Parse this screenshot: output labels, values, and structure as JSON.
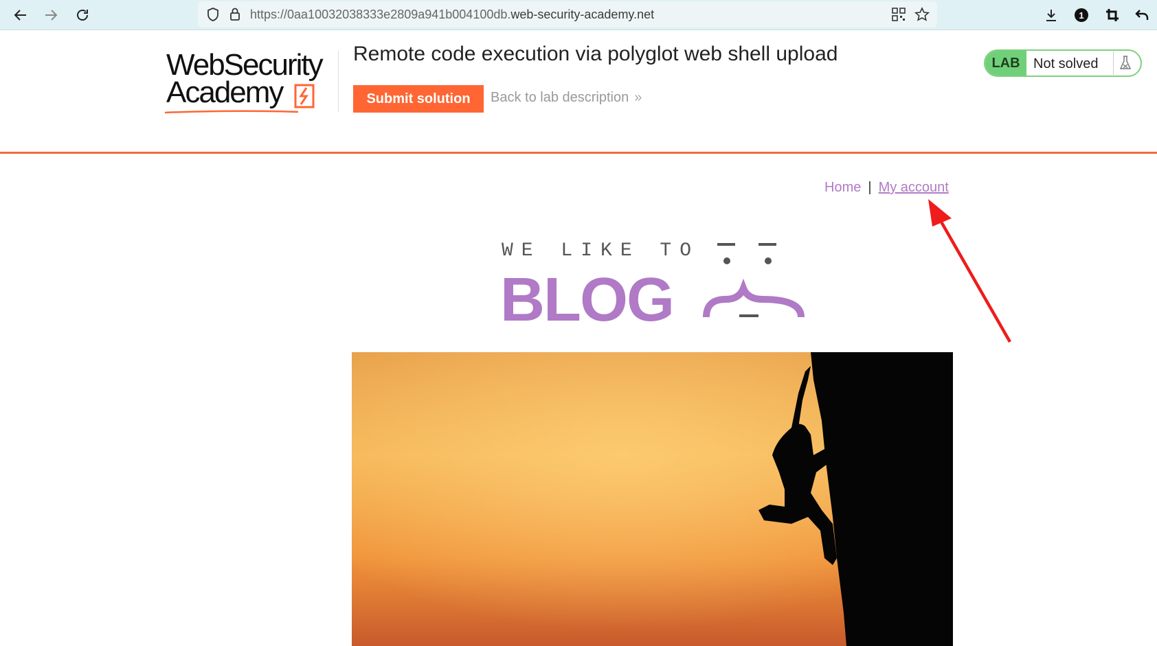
{
  "browser": {
    "url_prefix": "https://0aa10032038333e2809a941b004100db.",
    "url_domain": "web-security-academy.net",
    "badge_count": "1"
  },
  "lab": {
    "logo_line1": "WebSecurity",
    "logo_line2": "Academy",
    "title": "Remote code execution via polyglot web shell upload",
    "submit_label": "Submit solution",
    "back_label": "Back to lab description",
    "status_badge": "LAB",
    "status_text": "Not solved",
    "colors": {
      "accent": "#ff6633",
      "status_green": "#70d07a"
    }
  },
  "blog": {
    "nav": {
      "home": "Home",
      "separator": "|",
      "account": "My account"
    },
    "tagline": "WE LIKE TO",
    "title": "BLOG",
    "brand_color": "#b07ac6"
  }
}
